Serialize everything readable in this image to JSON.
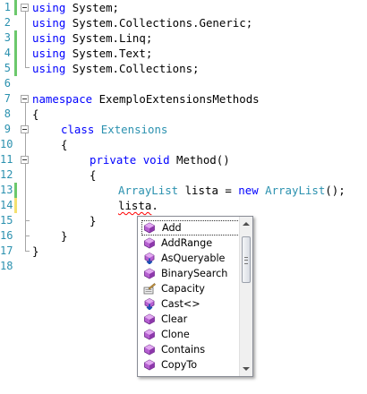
{
  "editor": {
    "line_numbers": [
      "1",
      "2",
      "3",
      "4",
      "5",
      "6",
      "7",
      "8",
      "9",
      "10",
      "11",
      "12",
      "13",
      "14",
      "15",
      "16",
      "17",
      "18"
    ],
    "lines": {
      "l1": {
        "kw": "using",
        "rest": " System;"
      },
      "l2": {
        "kw": "using",
        "rest": " System.Collections.Generic;"
      },
      "l3": {
        "kw": "using",
        "rest": " System.Linq;"
      },
      "l4": {
        "kw": "using",
        "rest": " System.Text;"
      },
      "l5": {
        "kw": "using",
        "rest": " System.Collections;"
      },
      "l7": {
        "kw": "namespace",
        "rest": " ExemploExtensionsMethods"
      },
      "l8": {
        "text": "{"
      },
      "l9": {
        "kw": "class",
        "type": "Extensions"
      },
      "l10": {
        "text": "{"
      },
      "l11": {
        "kw1": "private",
        "kw2": "void",
        "rest": " Method()"
      },
      "l12": {
        "text": "{"
      },
      "l13": {
        "type1": "ArrayList",
        "mid": " lista = ",
        "kw": "new",
        "type2": "ArrayList",
        "end": "();"
      },
      "l14": {
        "ident": "lista",
        "end": "."
      },
      "l15": {
        "text": "}"
      },
      "l16": {
        "text": "}"
      },
      "l17": {
        "text": "}"
      }
    }
  },
  "completion": {
    "items": [
      {
        "label": "Add",
        "icon": "method-icon",
        "selected": true
      },
      {
        "label": "AddRange",
        "icon": "method-icon"
      },
      {
        "label": "AsQueryable",
        "icon": "extension-method-icon"
      },
      {
        "label": "BinarySearch",
        "icon": "method-icon"
      },
      {
        "label": "Capacity",
        "icon": "property-icon"
      },
      {
        "label": "Cast<>",
        "icon": "extension-method-icon"
      },
      {
        "label": "Clear",
        "icon": "method-icon"
      },
      {
        "label": "Clone",
        "icon": "method-icon"
      },
      {
        "label": "Contains",
        "icon": "method-icon"
      },
      {
        "label": "CopyTo",
        "icon": "method-icon"
      }
    ]
  },
  "colors": {
    "keyword": "#0000ff",
    "type": "#2b91af",
    "line_number": "#2b91af",
    "change_saved": "#6cc86c",
    "change_unsaved": "#f4e16f"
  }
}
